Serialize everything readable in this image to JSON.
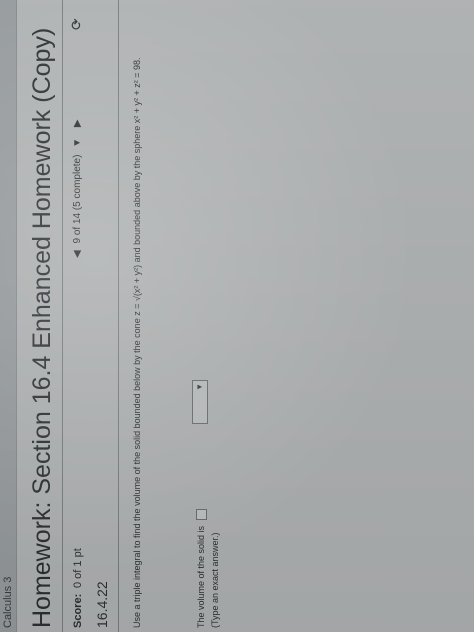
{
  "course": "Calculus 3",
  "homework_title": "Homework: Section 16.4 Enhanced Homework (Copy)",
  "score_label": "Score:",
  "score_value": "0 of 1 pt",
  "question_number": "16.4.22",
  "navigation": {
    "prev_arrow": "◀",
    "progress": "9 of 14 (5 complete)",
    "next_arrow": "▼",
    "extra_arrow": "▶"
  },
  "question_text": "Use a triple integral to find the volume of the solid bounded below by the cone z = √(x² + y²) and bounded above by the sphere x² + y² + z² = 98.",
  "answer_prompt": "The volume of the solid is",
  "answer_hint": "(Type an exact answer.)",
  "icons": {
    "help": "help-icon",
    "dropdown": "chevron-down-icon"
  }
}
